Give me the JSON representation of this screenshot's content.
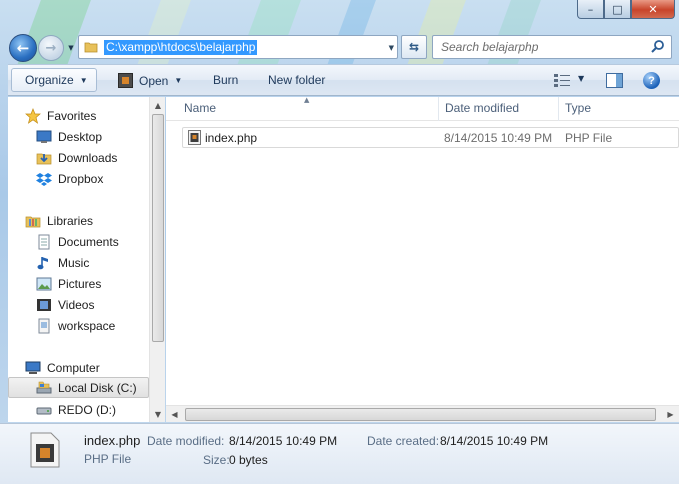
{
  "window": {
    "minimize_glyph": "–",
    "maximize_glyph": "□",
    "close_glyph": "✕"
  },
  "nav": {
    "address_path": "C:\\xampp\\htdocs\\belajarphp",
    "search_placeholder": "Search belajarphp"
  },
  "toolbar": {
    "organize": "Organize",
    "open": "Open",
    "burn": "Burn",
    "new_folder": "New folder"
  },
  "sidebar": {
    "items": [
      {
        "label": "Favorites",
        "icon": "star-icon"
      },
      {
        "label": "Desktop",
        "icon": "desktop-icon"
      },
      {
        "label": "Downloads",
        "icon": "downloads-icon"
      },
      {
        "label": "Dropbox",
        "icon": "dropbox-icon"
      },
      {
        "label": "Libraries",
        "icon": "libraries-icon"
      },
      {
        "label": "Documents",
        "icon": "documents-icon"
      },
      {
        "label": "Music",
        "icon": "music-icon"
      },
      {
        "label": "Pictures",
        "icon": "pictures-icon"
      },
      {
        "label": "Videos",
        "icon": "videos-icon"
      },
      {
        "label": "workspace",
        "icon": "workspace-icon"
      },
      {
        "label": "Computer",
        "icon": "computer-icon"
      },
      {
        "label": "Local Disk (C:)",
        "icon": "drive-icon",
        "selected": true
      },
      {
        "label": "REDO (D:)",
        "icon": "drive-icon"
      }
    ]
  },
  "columns": {
    "name": "Name",
    "date_modified": "Date modified",
    "type": "Type"
  },
  "files": [
    {
      "name": "index.php",
      "date_modified": "8/14/2015 10:49 PM",
      "type": "PHP File"
    }
  ],
  "details": {
    "file_name": "index.php",
    "file_type": "PHP File",
    "date_modified_label": "Date modified:",
    "date_modified_value": "8/14/2015 10:49 PM",
    "date_created_label": "Date created:",
    "date_created_value": "8/14/2015 10:49 PM",
    "size_label": "Size:",
    "size_value": "0 bytes"
  },
  "colors": {
    "selection": "#3399ff",
    "frame": "#b9d3ec",
    "label": "#5a6e86"
  }
}
